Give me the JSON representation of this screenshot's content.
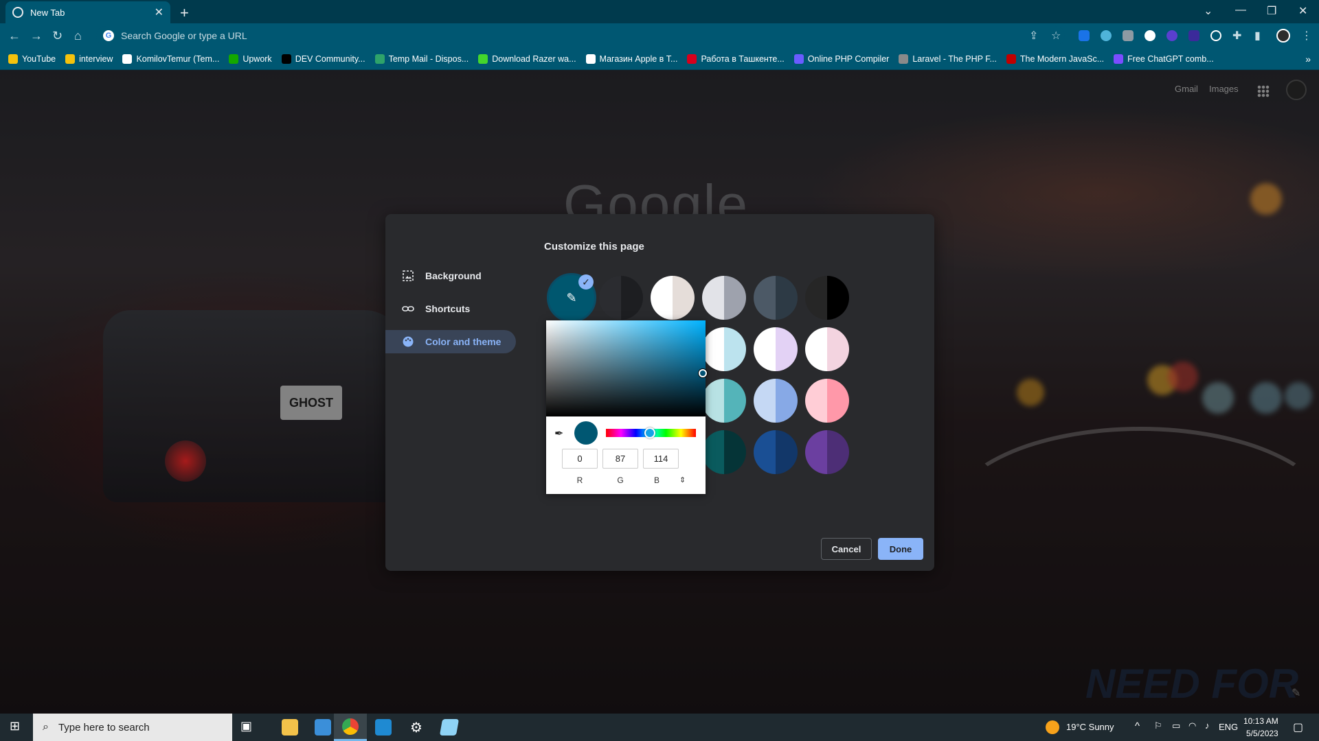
{
  "browser": {
    "tab_title": "New Tab",
    "omnibox_placeholder": "Search Google or type a URL",
    "bookmarks": [
      {
        "label": "YouTube",
        "color": "#f4c20d"
      },
      {
        "label": "interview",
        "color": "#f4c20d"
      },
      {
        "label": "KomilovTemur (Tem...",
        "color": "#ffffff"
      },
      {
        "label": "Upwork",
        "color": "#14a800"
      },
      {
        "label": "DEV Community...",
        "color": "#000000"
      },
      {
        "label": "Temp Mail - Dispos...",
        "color": "#2ea36a"
      },
      {
        "label": "Download Razer wa...",
        "color": "#44d62c"
      },
      {
        "label": "Магазин Apple в T...",
        "color": "#ffffff"
      },
      {
        "label": "Работа в Ташкенте...",
        "color": "#d6001c"
      },
      {
        "label": "Online PHP Compiler",
        "color": "#6a5cff"
      },
      {
        "label": "Laravel - The PHP F...",
        "color": "#8a8a8a"
      },
      {
        "label": "The Modern JavaSc...",
        "color": "#c00000"
      },
      {
        "label": "Free ChatGPT comb...",
        "color": "#7b4dff"
      }
    ]
  },
  "ntp": {
    "gmail_link": "Gmail",
    "images_link": "Images",
    "logo_text": "Google"
  },
  "dialog": {
    "title": "Customize this page",
    "nav": [
      {
        "label": "Background",
        "icon": "image-icon"
      },
      {
        "label": "Shortcuts",
        "icon": "link-icon"
      },
      {
        "label": "Color and theme",
        "icon": "palette-icon"
      }
    ],
    "cancel_label": "Cancel",
    "done_label": "Done",
    "selected_color": "#005772",
    "swatches": [
      {
        "left": "#2b2c30",
        "right": "#1d1e21"
      },
      {
        "left": "#ffffff",
        "right": "#e5ddd9"
      },
      {
        "left": "#e2e3e8",
        "right": "#9ea2ad"
      },
      {
        "left": "#4c5966",
        "right": "#2d3a45"
      },
      {
        "left": "#262626",
        "right": "#000000"
      },
      {
        "left": "#ffffff",
        "right": "#bce3ee"
      },
      {
        "left": "#ffffff",
        "right": "#e3d2f5"
      },
      {
        "left": "#ffffff",
        "right": "#f3d4e0"
      },
      {
        "left": "#b8e2e4",
        "right": "#54b4b9"
      },
      {
        "left": "#c5d8f4",
        "right": "#87a9e6"
      },
      {
        "left": "#ffcdd6",
        "right": "#ff98a9"
      },
      {
        "left": "#0a5b5e",
        "right": "#053437"
      },
      {
        "left": "#1a4f94",
        "right": "#123769"
      },
      {
        "left": "#6b3fa0",
        "right": "#4d2e76"
      }
    ]
  },
  "color_picker": {
    "r": "0",
    "g": "87",
    "b": "114",
    "r_label": "R",
    "g_label": "G",
    "b_label": "B",
    "format_toggle": "⇕"
  },
  "taskbar": {
    "search_placeholder": "Type here to search",
    "weather": "19°C  Sunny",
    "language": "ENG",
    "time": "10:13 AM",
    "date": "5/5/2023"
  }
}
